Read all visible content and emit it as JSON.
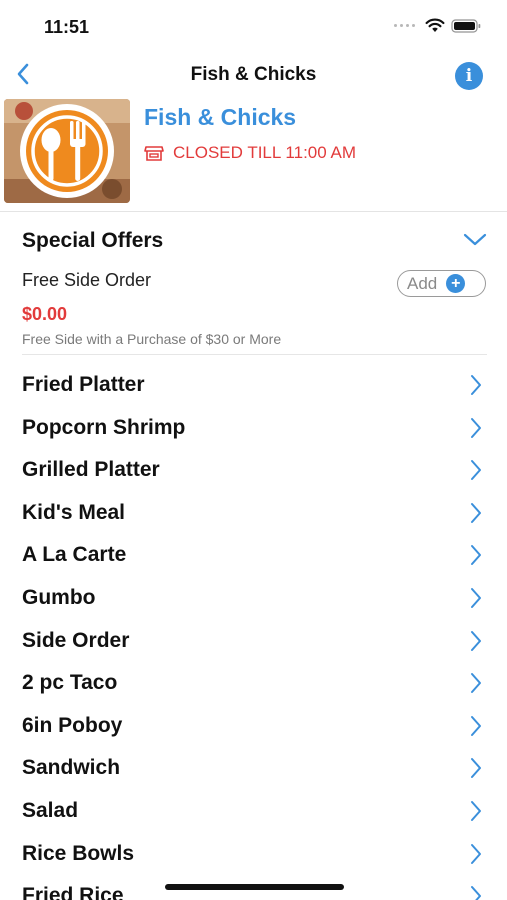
{
  "status_bar": {
    "time": "11:51"
  },
  "nav": {
    "title": "Fish & Chicks",
    "info_glyph": "i"
  },
  "store": {
    "name": "Fish & Chicks",
    "status": "CLOSED TILL 11:00 AM"
  },
  "special_offers": {
    "title": "Special Offers",
    "items": [
      {
        "name": "Free Side Order",
        "add_label": "Add",
        "price": "$0.00",
        "description": "Free Side with a Purchase of $30 or More"
      }
    ]
  },
  "categories": [
    {
      "label": "Fried Platter"
    },
    {
      "label": "Popcorn Shrimp"
    },
    {
      "label": "Grilled Platter"
    },
    {
      "label": "Kid's Meal"
    },
    {
      "label": "A La Carte"
    },
    {
      "label": "Gumbo"
    },
    {
      "label": "Side Order"
    },
    {
      "label": "2 pc Taco"
    },
    {
      "label": "6in Poboy"
    },
    {
      "label": "Sandwich"
    },
    {
      "label": "Salad"
    },
    {
      "label": "Rice Bowls"
    },
    {
      "label": "Fried Rice"
    }
  ],
  "colors": {
    "accent": "#3a8fdb",
    "alert": "#e23b3b",
    "logo_orange": "#ef8a1e"
  },
  "icons": {
    "back": "chevron-left-icon",
    "info": "info-icon",
    "store_status": "storefront-icon",
    "expand": "chevron-down-icon",
    "add": "plus-icon",
    "row": "chevron-right-icon"
  }
}
